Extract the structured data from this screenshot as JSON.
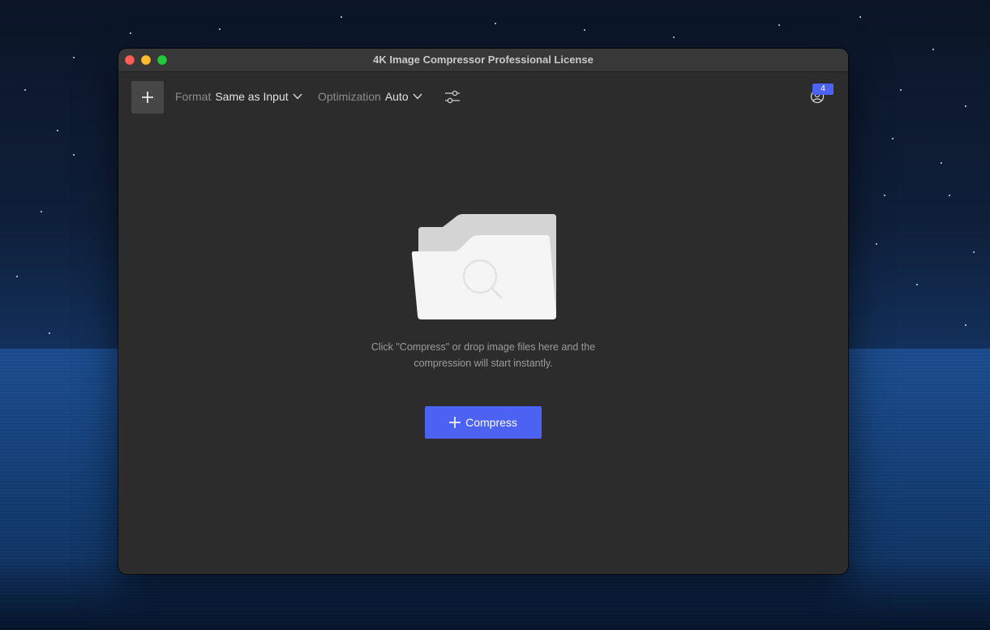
{
  "window": {
    "title": "4K Image Compressor Professional License"
  },
  "toolbar": {
    "add_icon": "plus-icon",
    "format": {
      "label": "Format",
      "value": "Same as Input"
    },
    "optimization": {
      "label": "Optimization",
      "value": "Auto"
    },
    "settings_icon": "sliders-icon",
    "account_icon": "account-icon",
    "notification_count": "4"
  },
  "main": {
    "hint_line1": "Click \"Compress\" or drop image files here and the",
    "hint_line2": "compression will start instantly.",
    "compress_label": "Compress"
  },
  "colors": {
    "accent": "#4c62f2",
    "window_bg": "#2c2c2c",
    "titlebar_bg": "#383838"
  }
}
